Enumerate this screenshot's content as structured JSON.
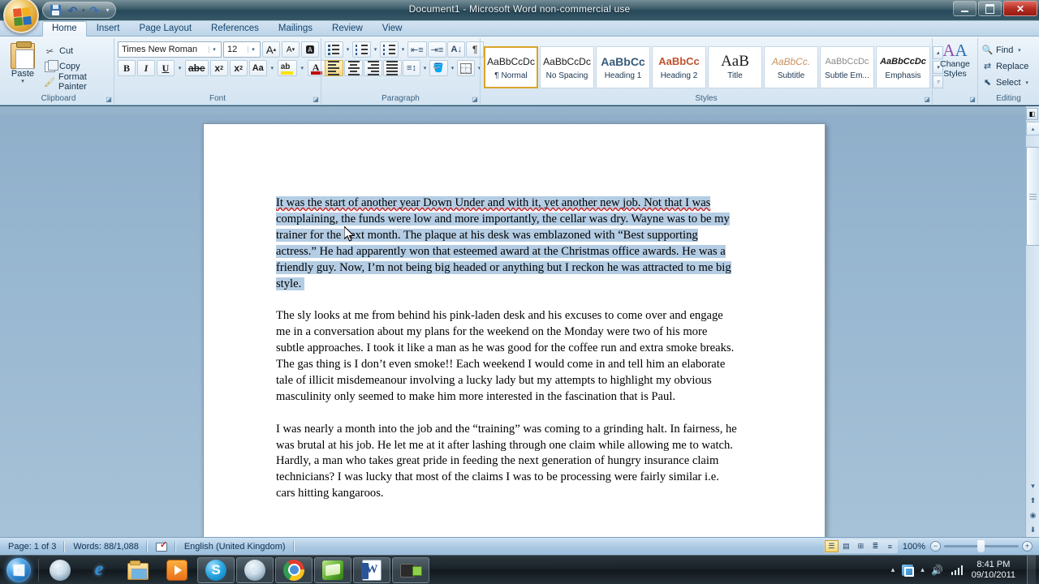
{
  "window": {
    "title": "Document1 - Microsoft Word non-commercial use",
    "minimize_label": "Minimize",
    "restore_label": "Restore",
    "close_label": "Close"
  },
  "quick_access": {
    "office_button": "Office Button",
    "items": [
      {
        "name": "save",
        "label": "Save"
      },
      {
        "name": "undo",
        "label": "Undo",
        "glyph": "↶"
      },
      {
        "name": "redo",
        "label": "Redo",
        "glyph": "↷"
      }
    ],
    "customize_glyph": "▾"
  },
  "ribbon": {
    "tabs": [
      {
        "label": "Home",
        "active": true
      },
      {
        "label": "Insert",
        "active": false
      },
      {
        "label": "Page Layout",
        "active": false
      },
      {
        "label": "References",
        "active": false
      },
      {
        "label": "Mailings",
        "active": false
      },
      {
        "label": "Review",
        "active": false
      },
      {
        "label": "View",
        "active": false
      }
    ],
    "clipboard": {
      "group_label": "Clipboard",
      "paste_label": "Paste",
      "cut_label": "Cut",
      "copy_label": "Copy",
      "format_painter_label": "Format Painter"
    },
    "font": {
      "group_label": "Font",
      "font_name": "Times New Roman",
      "font_size": "12",
      "grow_font_label": "Grow Font",
      "shrink_font_label": "Shrink Font",
      "clear_formatting_label": "Clear Formatting",
      "bold_label": "B",
      "italic_label": "I",
      "underline_label": "U",
      "strikethrough_label": "abe",
      "subscript_label": "x",
      "superscript_label": "x",
      "change_case_label": "Aa",
      "highlight_label": "Text Highlight Color",
      "font_color_label": "Font Color"
    },
    "paragraph": {
      "group_label": "Paragraph",
      "bullets_label": "Bullets",
      "numbering_label": "Numbering",
      "multilevel_label": "Multilevel List",
      "decrease_indent_label": "Decrease Indent",
      "increase_indent_label": "Increase Indent",
      "sort_label": "Sort",
      "show_marks_label": "¶",
      "align_left_label": "Align Text Left",
      "align_center_label": "Center",
      "align_right_label": "Align Text Right",
      "justify_label": "Justify",
      "line_spacing_label": "Line Spacing",
      "shading_label": "Shading",
      "borders_label": "Borders"
    },
    "styles": {
      "group_label": "Styles",
      "items": [
        {
          "sample": "AaBbCcDc",
          "name": "¶ Normal",
          "selected": true
        },
        {
          "sample": "AaBbCcDc",
          "name": "No Spacing",
          "selected": false
        },
        {
          "sample": "AaBbCс",
          "name": "Heading 1",
          "selected": false
        },
        {
          "sample": "AaBbCc",
          "name": "Heading 2",
          "selected": false
        },
        {
          "sample": "AaB",
          "name": "Title",
          "selected": false
        },
        {
          "sample": "AaBbCc.",
          "name": "Subtitle",
          "selected": false
        },
        {
          "sample": "AaBbCcDc",
          "name": "Subtle Em...",
          "selected": false
        },
        {
          "sample": "AaBbCcDc",
          "name": "Emphasis",
          "selected": false
        }
      ],
      "scroll_up": "▴",
      "scroll_down": "▾",
      "more": "▿"
    },
    "change_styles": {
      "label_line1": "Change",
      "label_line2": "Styles"
    },
    "editing": {
      "group_label": "Editing",
      "find_label": "Find",
      "replace_label": "Replace",
      "select_label": "Select"
    }
  },
  "document": {
    "paragraphs": [
      {
        "selected": true,
        "lines": [
          {
            "text": "It was the start of another year Down Under and with it, yet another new job. Not that I was",
            "spell_error": true,
            "highlight": true
          },
          {
            "text": "complaining, the funds were low and more importantly, the cellar was dry. Wayne was to be my",
            "spell_error": false,
            "highlight": true
          },
          {
            "text": "trainer for the next month. The plaque at his desk was emblazoned with “Best supporting",
            "spell_error": false,
            "highlight": true
          },
          {
            "text": "actress.” He had apparently won that esteemed award at the Christmas office awards. He was a",
            "spell_error": false,
            "highlight": true
          },
          {
            "text": "friendly guy. Now, I’m not being big headed or anything but I reckon he was attracted to me big",
            "spell_error": false,
            "highlight": true
          },
          {
            "text": "style. ",
            "spell_error": false,
            "highlight": true
          }
        ]
      },
      {
        "selected": false,
        "lines": [
          {
            "text": "The sly looks at me from behind his pink-laden desk and his excuses to come over and engage",
            "spell_error": false,
            "highlight": false
          },
          {
            "text": "me in a conversation about my plans for the weekend on the Monday were two of his more",
            "spell_error": false,
            "highlight": false
          },
          {
            "text": "subtle approaches. I took it like a man as he was good for the coffee run and extra smoke breaks.",
            "spell_error": false,
            "highlight": false
          },
          {
            "text": "The gas thing is I don’t even smoke!! Each weekend I would come in and tell him an elaborate",
            "spell_error": false,
            "highlight": false
          },
          {
            "text": "tale of illicit misdemeanour involving a lucky lady but my attempts to highlight my obvious",
            "spell_error": false,
            "highlight": false
          },
          {
            "text": "masculinity only seemed to make him more interested in the fascination that is Paul.",
            "spell_error": false,
            "highlight": false
          }
        ]
      },
      {
        "selected": false,
        "lines": [
          {
            "text": "I was nearly a month into the job and the “training” was coming to a grinding halt. In fairness, he",
            "spell_error": false,
            "highlight": false
          },
          {
            "text": "was brutal at his job. He let me at it after lashing through one claim while allowing me to watch.",
            "spell_error": false,
            "highlight": false
          },
          {
            "text": "Hardly, a man who takes great pride in feeding the next generation of hungry insurance claim",
            "spell_error": false,
            "highlight": false
          },
          {
            "text": "technicians? I was lucky that most of the claims I was to be processing were fairly similar i.e.",
            "spell_error": false,
            "highlight": false
          },
          {
            "text": "cars hitting kangaroos.",
            "spell_error": false,
            "highlight": false
          }
        ]
      }
    ]
  },
  "scrollbar": {
    "up_arrow": "▴",
    "down_arrow": "▾",
    "previous_page": "⬆",
    "select_browse_object": "◉",
    "next_page": "⬇",
    "browse_split": "▭"
  },
  "statusbar": {
    "page": "Page: 1 of 3",
    "words": "Words: 88/1,088",
    "language": "English (United Kingdom)",
    "proofing_label": "Proofing errors",
    "views": [
      {
        "name": "print-layout",
        "glyph": "☰",
        "active": true
      },
      {
        "name": "full-screen-reading",
        "glyph": "▤",
        "active": false
      },
      {
        "name": "web-layout",
        "glyph": "⊞",
        "active": false
      },
      {
        "name": "outline",
        "glyph": "≣",
        "active": false
      },
      {
        "name": "draft",
        "glyph": "≡",
        "active": false
      }
    ],
    "zoom": "100%",
    "zoom_out": "−",
    "zoom_in": "+"
  },
  "taskbar": {
    "start_label": "Start",
    "items": [
      {
        "name": "internet-explorer-quicklaunch-icon",
        "kind": "ie-flat",
        "running": false
      },
      {
        "name": "internet-explorer-icon",
        "kind": "ie2",
        "running": false
      },
      {
        "name": "windows-explorer-icon",
        "kind": "explorer",
        "running": false
      },
      {
        "name": "windows-media-player-icon",
        "kind": "wmp",
        "running": false
      },
      {
        "name": "skype-icon",
        "kind": "skype",
        "running": true,
        "glyph": "S"
      },
      {
        "name": "internet-explorer-window-icon",
        "kind": "ie-flat",
        "running": true
      },
      {
        "name": "google-chrome-icon",
        "kind": "chrome",
        "running": true
      },
      {
        "name": "green-app-icon",
        "kind": "green",
        "running": true
      },
      {
        "name": "microsoft-word-icon",
        "kind": "word",
        "running": true
      },
      {
        "name": "screen-recorder-icon",
        "kind": "cam",
        "running": true
      }
    ],
    "tray": {
      "show_hidden_glyph": "▴",
      "network_label": "Network",
      "volume_glyph": "🔊",
      "time": "8:41 PM",
      "date": "09/10/2011"
    }
  }
}
